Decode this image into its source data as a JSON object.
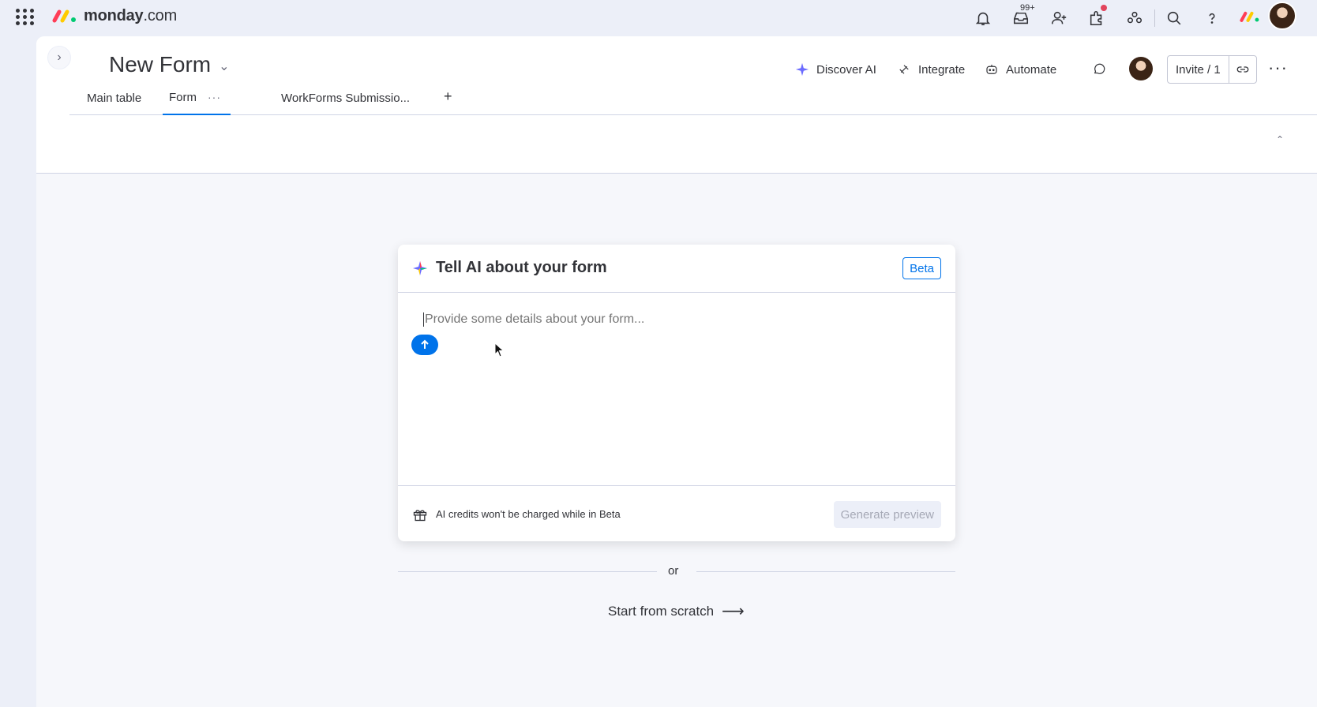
{
  "brand": {
    "name": "monday",
    "suffix": ".com",
    "colors": [
      "#ff3d57",
      "#ffcb00",
      "#00ca72"
    ]
  },
  "topbar": {
    "inbox_badge": "99+",
    "icons": [
      "apps-grid-icon",
      "bell-icon",
      "inbox-icon",
      "invite-person-icon",
      "apps-marketplace-icon",
      "teams-icon",
      "search-icon",
      "help-icon"
    ]
  },
  "board": {
    "title": "New Form",
    "actions": {
      "discover_ai": "Discover AI",
      "integrate": "Integrate",
      "automate": "Automate",
      "invite": "Invite / 1"
    },
    "tabs": [
      {
        "label": "Main table"
      },
      {
        "label": "Form",
        "active": true
      },
      {
        "label": "WorkForms Submissio..."
      }
    ],
    "add_tab": "+"
  },
  "ai_card": {
    "title": "Tell AI about your form",
    "badge": "Beta",
    "placeholder": "Provide some details about your form...",
    "credits_note": "AI credits won't be charged while in Beta",
    "generate_label": "Generate preview"
  },
  "divider_text": "or",
  "start_scratch": {
    "label": "Start from scratch",
    "arrow": "⟶"
  },
  "colors": {
    "accent": "#0073ea",
    "background": "#eceff8",
    "card": "#ffffff"
  }
}
